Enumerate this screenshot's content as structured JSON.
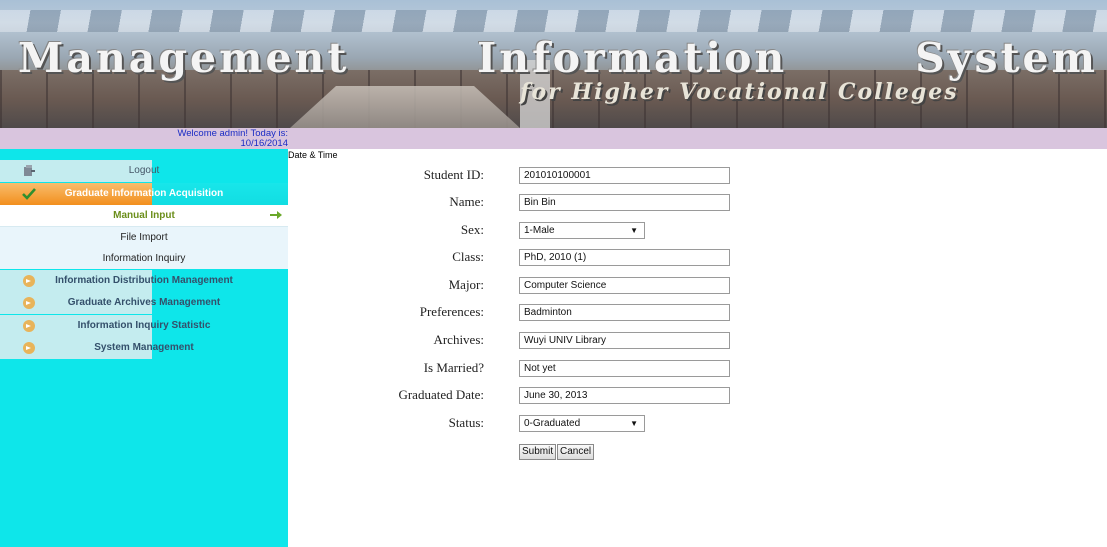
{
  "banner": {
    "title": "Management Information System",
    "subtitle": "for Higher Vocational Colleges"
  },
  "welcome": {
    "greeting": "Welcome admin! Today is:",
    "date": "10/16/2014",
    "datetime_label": "Date & Time"
  },
  "sidebar": {
    "logout": "Logout",
    "acquisition": "Graduate Information Acquisition",
    "sub_items": [
      "Manual Input",
      "File Import",
      "Information Inquiry"
    ],
    "groups": [
      "Information Distribution Management",
      "Graduate Archives Management",
      "Information Inquiry Statistic",
      "System Management"
    ]
  },
  "form": {
    "fields": [
      {
        "label": "Student ID:",
        "value": "201010100001",
        "type": "text"
      },
      {
        "label": "Name:",
        "value": "Bin Bin",
        "type": "text"
      },
      {
        "label": "Sex:",
        "value": "1-Male",
        "type": "select"
      },
      {
        "label": "Class:",
        "value": "PhD, 2010 (1)",
        "type": "text"
      },
      {
        "label": "Major:",
        "value": "Computer Science",
        "type": "text"
      },
      {
        "label": "Preferences:",
        "value": "Badminton",
        "type": "text"
      },
      {
        "label": "Archives:",
        "value": "Wuyi UNIV Library",
        "type": "text"
      },
      {
        "label": "Is Married?",
        "value": "Not yet",
        "type": "text"
      },
      {
        "label": "Graduated Date:",
        "value": "June 30, 2013",
        "type": "text"
      },
      {
        "label": "Status:",
        "value": "0-Graduated",
        "type": "select"
      }
    ],
    "submit_label": "Submit",
    "cancel_label": "Cancel"
  },
  "colors": {
    "sidebar": "#0ee6ea",
    "welcome_bar": "#d9c5de",
    "active_menu": "#f28f1d",
    "active_sub_text": "#6b8e1a",
    "welcome_text": "#1a2cc4"
  },
  "icons": {
    "logout": "logout-icon",
    "acquisition": "checkmark-icon",
    "group": "folder-arrow-icon",
    "active_sub": "right-arrow-icon"
  }
}
